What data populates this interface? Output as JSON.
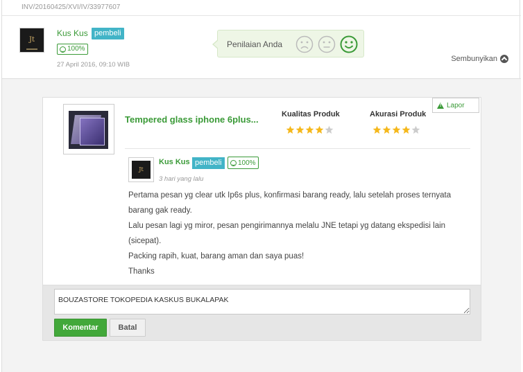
{
  "invoice": "INV/20160425/XVI/IV/33977607",
  "buyer": {
    "name": "Kus Kus",
    "role_badge": "pembeli",
    "reputation": "100%",
    "date": "27 April 2016, 09:10 WIB"
  },
  "rating_prompt": {
    "label": "Penilaian Anda",
    "faces": [
      "sad-face-icon",
      "neutral-face-icon",
      "happy-face-icon"
    ],
    "selected": "happy-face-icon"
  },
  "hide_link": "Sembunyikan",
  "report_button": "Lapor",
  "product": {
    "title": "Tempered glass iphone 6plus...",
    "quality_label": "Kualitas Produk",
    "quality_stars": 4,
    "accuracy_label": "Akurasi Produk",
    "accuracy_stars": 4,
    "max_stars": 5
  },
  "review": {
    "name": "Kus Kus",
    "role_badge": "pembeli",
    "reputation": "100%",
    "time": "3 hari yang lalu",
    "lines": [
      "Pertama pesan yg clear utk Ip6s plus, konfirmasi barang ready, lalu setelah proses ternyata barang gak ready.",
      "Lalu pesan lagi yg miror, pesan pengirimannya melalu JNE tetapi yg datang ekspedisi lain (sicepat).",
      "Packing rapih, kuat, barang aman dan saya puas!",
      "Thanks"
    ]
  },
  "comment": {
    "value": "BOUZASTORE TOKOPEDIA KASKUS BUKALAPAK",
    "submit_label": "Komentar",
    "cancel_label": "Batal"
  },
  "colors": {
    "accent_green": "#3a9a37",
    "badge_blue": "#42b4c7",
    "star_gold": "#f5b81c",
    "star_empty": "#cccccc"
  }
}
